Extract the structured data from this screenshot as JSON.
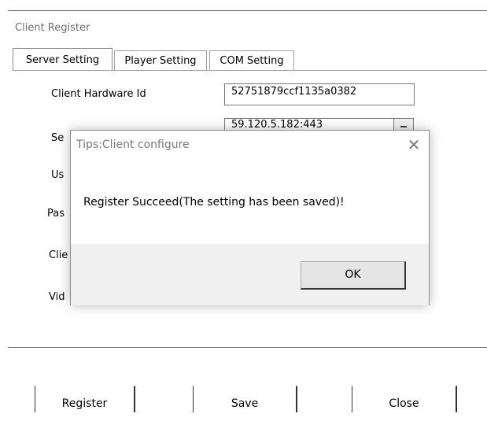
{
  "window": {
    "title": "Client Register"
  },
  "tabs": [
    {
      "label": "Server Setting",
      "selected": true
    },
    {
      "label": "Player Setting",
      "selected": false
    },
    {
      "label": "COM Setting",
      "selected": false
    }
  ],
  "form": {
    "hardware_id_label": "Client Hardware Id",
    "hardware_id_value": "52751879ccf1135a0382",
    "server_address_label": "Se",
    "server_address_value": "59.120.5.182:443",
    "user_label": "Us",
    "password_label": "Pas",
    "client_label": "Clie",
    "video_label": "Vid"
  },
  "buttons": {
    "register": "Register",
    "save": "Save",
    "close": "Close"
  },
  "dialog": {
    "title": "Tips:Client configure",
    "close_icon": "close-icon",
    "message": "Register Succeed(The setting has been saved)!",
    "ok": "OK"
  }
}
